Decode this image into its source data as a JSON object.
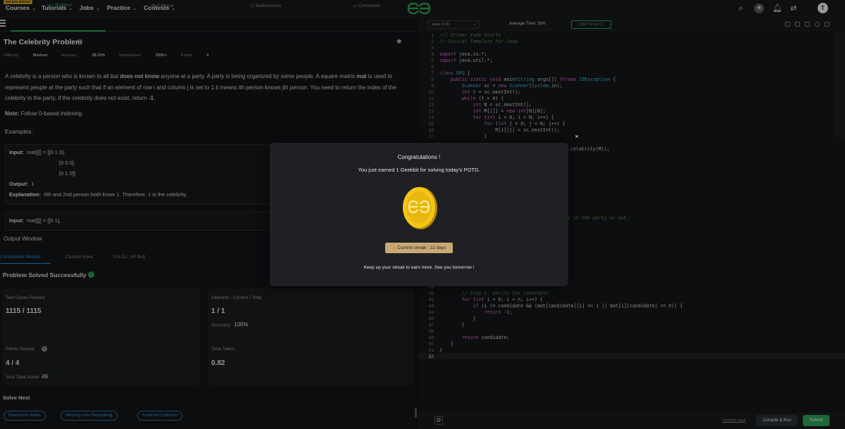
{
  "nav": {
    "promo": "Get 90% Refund",
    "items": [
      "Courses",
      "Tutorials",
      "Jobs",
      "Practice",
      "Contests"
    ],
    "avatar_letter": "T"
  },
  "tabs": [
    "Problem",
    "Editorial",
    "Submissions",
    "Comments"
  ],
  "problem": {
    "title": "The Celebrity Problem",
    "difficulty_label": "Difficulty:",
    "difficulty": "Medium",
    "accuracy_label": "Accuracy:",
    "accuracy": "38.33%",
    "submissions_label": "Submissions:",
    "submissions": "250K+",
    "points_label": "Points:",
    "points": "4",
    "desc_1": "A celebrity is a person who is known to all but ",
    "desc_bold_1": "does not know",
    "desc_2": " anyone at a party. A party is being organized by some people.  A square matrix ",
    "desc_bold_2": "mat",
    "desc_3": " is used to represent people at the party such that if an element of row i and column j is set to 1 it means ith person knows jth person. You need to return the index of the celebrity in the party, if the celebrity does not exist, return ",
    "desc_bold_3": "-1",
    "desc_4": ".",
    "note_label": "Note:",
    "note": " Follow 0-based indexing.",
    "examples_header": "Examples:",
    "ex1_input_label": "Input:",
    "ex1_input_1": "mat[][] = [[0 1 0],",
    "ex1_input_2": "[0 0 0],",
    "ex1_input_3": "[0 1 0]]",
    "ex1_output_label": "Output:",
    "ex1_output": "1",
    "ex1_expl_label": "Explanation:",
    "ex1_expl": "0th and 2nd person both know 1. Therefore, 1 is the celebrity.",
    "ex2_input_label": "Input:",
    "ex2_input_1": "mat[][] = [[0 1],"
  },
  "output": {
    "title": "Output Window",
    "tabs": [
      "Compilation Results",
      "Custom Input",
      "Y.O.G.I. (AI Bot)"
    ],
    "solved": "Problem Solved Successfully",
    "test_label": "Test Cases Passed",
    "test_value": "1115 / 1115",
    "attempts_label": "Attempts : Correct / Total",
    "attempts_value": "1 / 1",
    "accuracy_label": "Accuracy :",
    "accuracy_value": "100%",
    "points_label": "Points Scored",
    "points_value": "4 / 4",
    "total_label": "Your Total Score:",
    "total_value": "49",
    "time_label": "Time Taken",
    "time_value": "0.82",
    "solve_next": "Solve Next",
    "next_chips": [
      "Maximum Index",
      "Missing And Repeating",
      "Asteroid Collision"
    ]
  },
  "editor": {
    "language": "Java (1.8)",
    "avg_time": "Average Time: 30m",
    "timer": "Start Timer",
    "custom_input": "Custom Input",
    "compile": "Compile & Run",
    "submit": "Submit",
    "code_top": [
      [
        "1",
        "//{ Driver Code Starts"
      ],
      [
        "2",
        "// Initial Template for Java"
      ],
      [
        "3",
        ""
      ],
      [
        "4",
        "import java.io.*;"
      ],
      [
        "5",
        "import java.util.*;"
      ],
      [
        "6",
        ""
      ],
      [
        "7",
        "class GFG {"
      ],
      [
        "8",
        "    public static void main(String args[]) throws IOException {"
      ],
      [
        "9",
        "        Scanner sc = new Scanner(System.in);"
      ],
      [
        "10",
        "        int t = sc.nextInt();"
      ],
      [
        "11",
        "        while (t > 0) {"
      ],
      [
        "12",
        "            int N = sc.nextInt();"
      ],
      [
        "13",
        "            int M[][] = new int[N][N];"
      ],
      [
        "14",
        "            for (int i = 0; i < N; i++) {"
      ],
      [
        "15",
        "                for (int j = 0; j < N; j++) {"
      ],
      [
        "16",
        "                    M[i][j] = sc.nextInt();"
      ],
      [
        "17",
        "                }"
      ]
    ],
    "code_peek_1": ".celebrity(M));",
    "code_peek_2": "y in the party or not.",
    "code_bottom": [
      [
        "41",
        ""
      ],
      [
        "42",
        "        // Step 2: Verify the candidate"
      ],
      [
        "43",
        "        for (int i = 0; i < n; i++) {"
      ],
      [
        "44",
        "            if (i != candidate && (mat[candidate][i] == 1 || mat[i][candidate] == 0)) {"
      ],
      [
        "45",
        "                return -1;"
      ],
      [
        "46",
        "            }"
      ],
      [
        "47",
        "        }"
      ],
      [
        "48",
        ""
      ],
      [
        "49",
        "        return candidate;"
      ],
      [
        "50",
        "    }"
      ],
      [
        "51",
        "}"
      ],
      [
        "52",
        ""
      ]
    ]
  },
  "modal": {
    "title": "Congratulations !",
    "text": "You just earned 1 Geekbit for solving today's POTD.",
    "streak": "Current streak : 11 days",
    "footer": "Keep up your streak to earn more. See you tomorrow !",
    "close": "×"
  }
}
